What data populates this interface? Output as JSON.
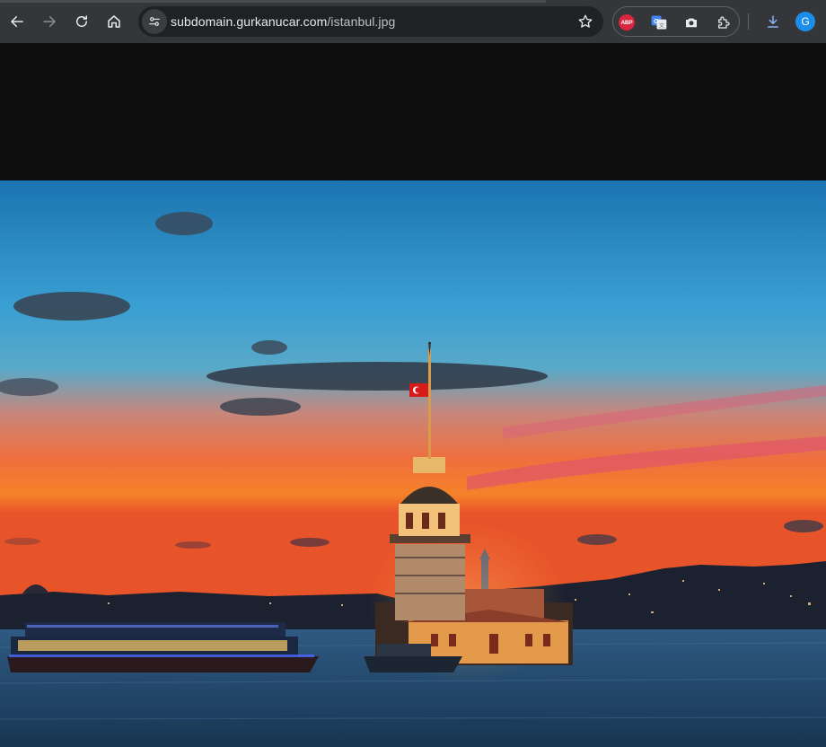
{
  "browser": {
    "address": {
      "domain": "subdomain.gurkanucar.com",
      "path": "/istanbul.jpg"
    },
    "extensions": [
      {
        "name": "adblock-plus",
        "label": "ABP"
      },
      {
        "name": "google-translate",
        "label": "G"
      }
    ],
    "profile_initial": "G"
  },
  "colors": {
    "toolbar": "#35363a",
    "omnibox": "#202124",
    "page_background": "#0e0e0e",
    "sky_top": "#1e78b4",
    "sunset_orange": "#f07a2a",
    "water": "#1c3d5c",
    "abp_red": "#d7263d",
    "avatar_blue": "#1a8ee8"
  }
}
